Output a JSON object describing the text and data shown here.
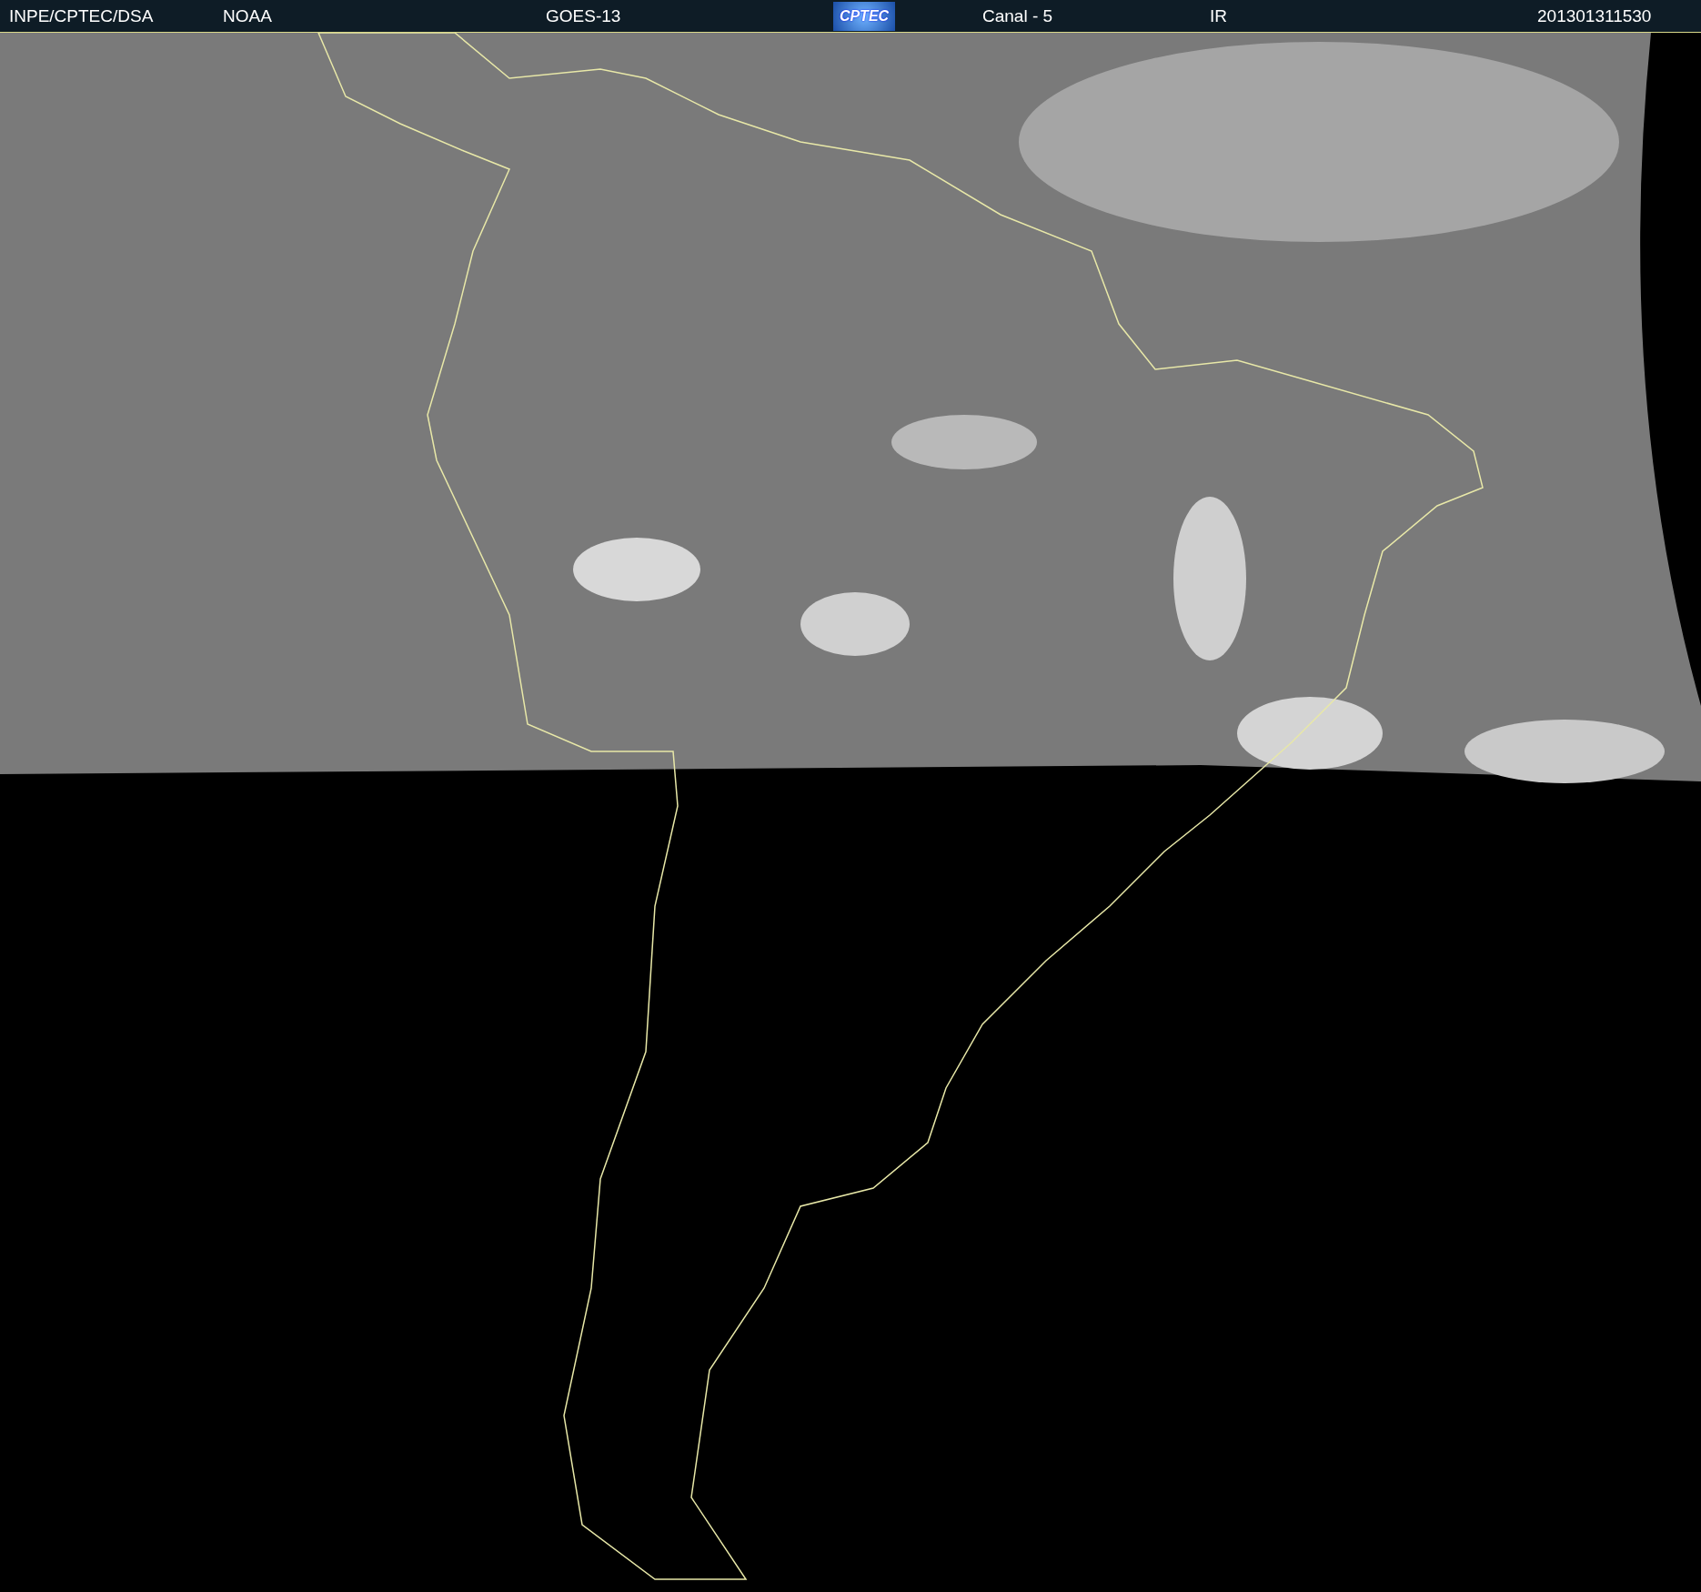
{
  "header": {
    "items": [
      {
        "kind": "text",
        "label": "INPE/CPTEC/DSA"
      },
      {
        "kind": "text",
        "label": "NOAA"
      },
      {
        "kind": "text",
        "label": "GOES-13"
      },
      {
        "kind": "logo",
        "label": "CPTEC"
      },
      {
        "kind": "text",
        "label": "Canal - 5"
      },
      {
        "kind": "text",
        "label": "IR"
      },
      {
        "kind": "text",
        "label": "201301311530"
      }
    ]
  }
}
